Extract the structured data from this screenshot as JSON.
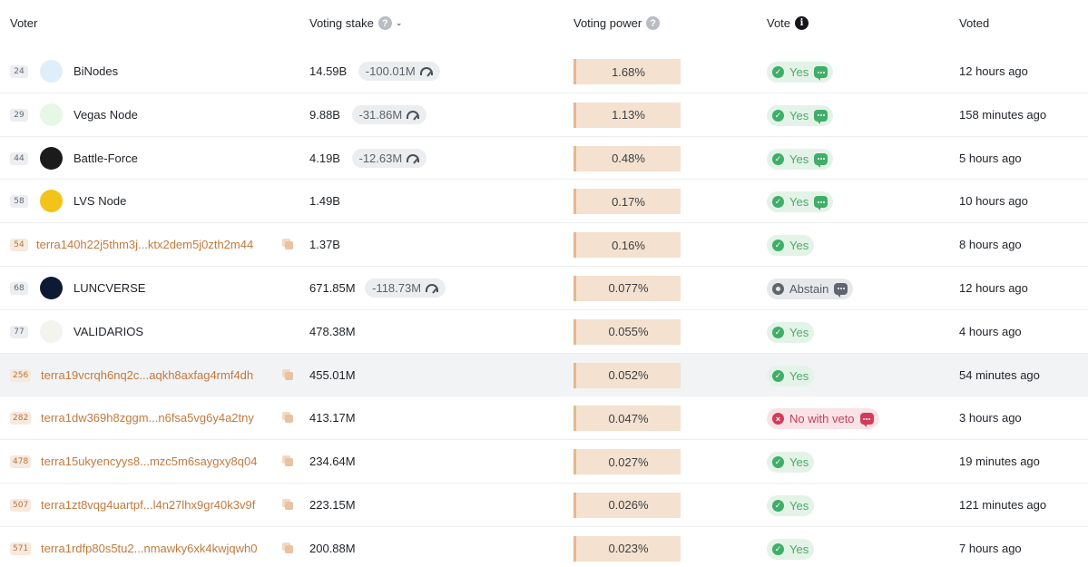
{
  "header": {
    "voter": "Voter",
    "stake": "Voting stake",
    "power": "Voting power",
    "vote": "Vote",
    "voted": "Voted"
  },
  "rows": [
    {
      "rank": "24",
      "kind": "validator",
      "name": "BiNodes",
      "logo": "binodes-logo",
      "logo_color": "#dfeefb",
      "stake": "14.59B",
      "delta": "-100.01M",
      "power": "1.68%",
      "vote": "Yes",
      "vote_kind": "yes",
      "memo": true,
      "voted": "12 hours ago"
    },
    {
      "rank": "29",
      "kind": "validator",
      "name": "Vegas Node",
      "logo": "vegas-node-logo",
      "logo_color": "#e6f7e6",
      "stake": "9.88B",
      "delta": "-31.86M",
      "power": "1.13%",
      "vote": "Yes",
      "vote_kind": "yes",
      "memo": true,
      "voted": "158 minutes ago"
    },
    {
      "rank": "44",
      "kind": "validator",
      "name": "Battle-Force",
      "logo": "battle-force-logo",
      "logo_color": "#1b1b1b",
      "stake": "4.19B",
      "delta": "-12.63M",
      "power": "0.48%",
      "vote": "Yes",
      "vote_kind": "yes",
      "memo": true,
      "voted": "5 hours ago"
    },
    {
      "rank": "58",
      "kind": "validator",
      "name": "LVS Node",
      "logo": "lvs-node-logo",
      "logo_color": "#f2c319",
      "stake": "1.49B",
      "delta": "",
      "power": "0.17%",
      "vote": "Yes",
      "vote_kind": "yes",
      "memo": true,
      "voted": "10 hours ago"
    },
    {
      "rank": "54",
      "kind": "address",
      "name": "terra140h22j5thm3j...ktx2dem5j0zth2m44",
      "stake": "1.37B",
      "delta": "",
      "power": "0.16%",
      "vote": "Yes",
      "vote_kind": "yes",
      "memo": false,
      "voted": "8 hours ago"
    },
    {
      "rank": "68",
      "kind": "validator",
      "name": "LUNCVERSE",
      "logo": "luncverse-logo",
      "logo_color": "#0e1a33",
      "stake": "671.85M",
      "delta": "-118.73M",
      "power": "0.077%",
      "vote": "Abstain",
      "vote_kind": "abstain",
      "memo": true,
      "voted": "12 hours ago"
    },
    {
      "rank": "77",
      "kind": "validator",
      "name": "VALIDARIOS",
      "logo": "validarios-logo",
      "logo_color": "#f4f4ef",
      "stake": "478.38M",
      "delta": "",
      "power": "0.055%",
      "vote": "Yes",
      "vote_kind": "yes",
      "memo": false,
      "voted": "4 hours ago"
    },
    {
      "rank": "256",
      "kind": "address",
      "name": "terra19vcrqh6nq2c...aqkh8axfag4rmf4dh",
      "stake": "455.01M",
      "delta": "",
      "power": "0.052%",
      "vote": "Yes",
      "vote_kind": "yes",
      "memo": false,
      "voted": "54 minutes ago",
      "highlight": true
    },
    {
      "rank": "282",
      "kind": "address",
      "name": "terra1dw369h8zggm...n6fsa5vg6y4a2tny",
      "stake": "413.17M",
      "delta": "",
      "power": "0.047%",
      "vote": "No with veto",
      "vote_kind": "veto",
      "memo": true,
      "voted": "3 hours ago"
    },
    {
      "rank": "478",
      "kind": "address",
      "name": "terra15ukyencyys8...mzc5m6saygxy8q04",
      "stake": "234.64M",
      "delta": "",
      "power": "0.027%",
      "vote": "Yes",
      "vote_kind": "yes",
      "memo": false,
      "voted": "19 minutes ago"
    },
    {
      "rank": "507",
      "kind": "address",
      "name": "terra1zt8vqg4uartpf...l4n27lhx9gr40k3v9f",
      "stake": "223.15M",
      "delta": "",
      "power": "0.026%",
      "vote": "Yes",
      "vote_kind": "yes",
      "memo": false,
      "voted": "121 minutes ago"
    },
    {
      "rank": "571",
      "kind": "address",
      "name": "terra1rdfp80s5tu2...nmawky6xk4kwjqwh0",
      "stake": "200.88M",
      "delta": "",
      "power": "0.023%",
      "vote": "Yes",
      "vote_kind": "yes",
      "memo": false,
      "voted": "7 hours ago"
    }
  ]
}
